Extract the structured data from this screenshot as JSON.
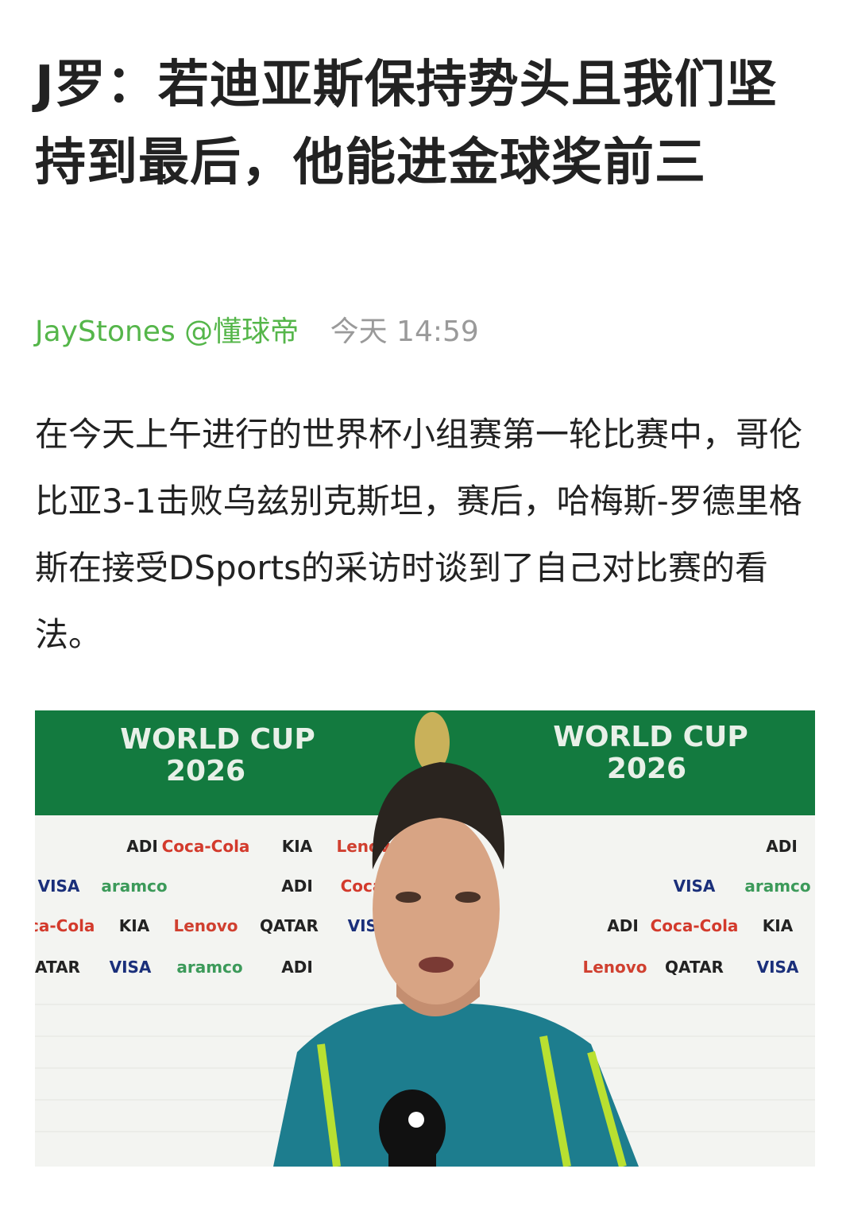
{
  "article": {
    "title": "J罗：若迪亚斯保持势头且我们坚持到最后，他能进金球奖前三",
    "author": "JayStones @懂球帝",
    "time": "今天 14:59",
    "body": "在今天上午进行的世界杯小组赛第一轮比赛中，哥伦比亚3-1击败乌兹别克斯坦，赛后，哈梅斯-罗德里格斯在接受DSports的采访时谈到了自己对比赛的看法。"
  },
  "photo": {
    "banner_left_line1": "WORLD CUP",
    "banner_left_line2": "2026",
    "banner_right_line1": "WORLD CUP",
    "banner_right_line2": "2026",
    "sponsors": {
      "row1": [
        "ADI",
        "Coca-Cola",
        "KIA",
        "Lenovo",
        "ADI"
      ],
      "row2": [
        "VISA",
        "aramco",
        "ADI",
        "Coca-Cola",
        "VISA",
        "aramco"
      ],
      "row3": [
        "Coca-Cola",
        "KIA",
        "Lenovo",
        "QATAR",
        "VISA",
        "ADI",
        "Coca-Cola",
        "KIA"
      ],
      "row4": [
        "QATAR",
        "VISA",
        "aramco",
        "ADI",
        "Lenovo",
        "QATAR",
        "VISA"
      ]
    },
    "colors": {
      "banner_green": "#137a3f",
      "jersey_blue": "#1d7d8e",
      "jersey_stripe": "#b9e031"
    }
  }
}
